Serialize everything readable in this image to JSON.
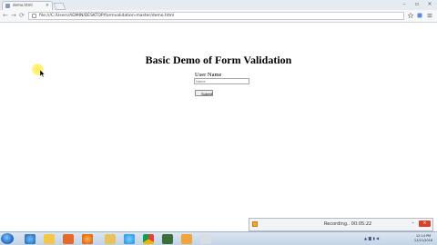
{
  "browser": {
    "tab_title": "demo.html",
    "tab_close": "×",
    "url": "file:///C:/Users/ADMIN/DESKTOP/formvalidation-master/demo.html",
    "window_controls": [
      "–",
      "▫",
      "×"
    ],
    "nav": {
      "back": "←",
      "forward": "→",
      "reload": "⟳"
    }
  },
  "page": {
    "heading": "Basic Demo of Form Validation",
    "username_label": "User Name",
    "username_placeholder": "Name",
    "submit_label": "Submit"
  },
  "recording": {
    "text": "Recording.. 00:05:22",
    "minimize": "–",
    "close": "×"
  },
  "taskbar": {
    "time": "12:14 PM",
    "date": "12/11/2016",
    "apps": [
      "ie-icon",
      "explorer-icon",
      "media-icon",
      "firefox-icon",
      "folder-icon",
      "skype-icon",
      "chrome-icon",
      "dreamweaver-icon",
      "paint-icon",
      "recorder-icon"
    ]
  },
  "colors": {
    "accent": "#1c63b8",
    "recording_close": "#d9402b",
    "cursor_highlight": "#ffef5a"
  }
}
